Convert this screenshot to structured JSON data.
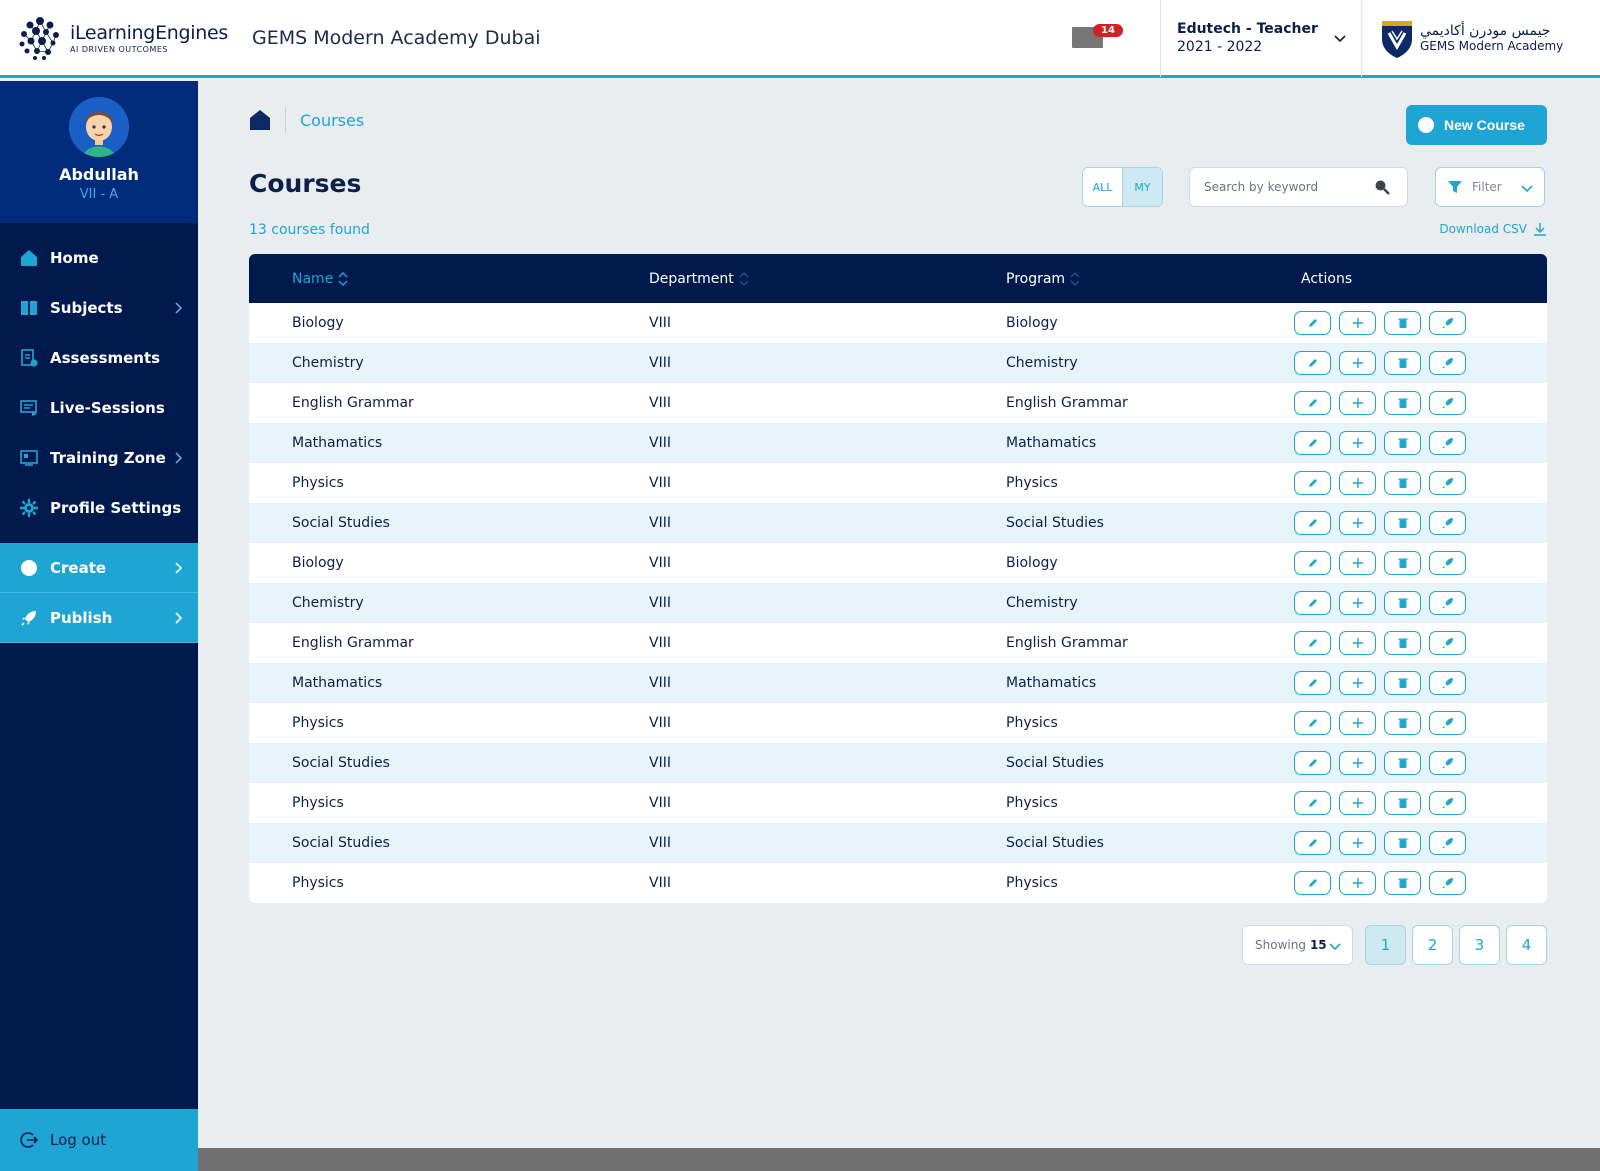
{
  "header": {
    "brand_name": "iLearningEngines",
    "brand_tag": "AI DRIVEN OUTCOMES",
    "school_name": "GEMS Modern Academy Dubai",
    "notification_count": "14",
    "role_title": "Edutech - Teacher",
    "role_year": "2021 - 2022",
    "partner_arabic": "جيمس مودرن أكاديمي",
    "partner_english": "GEMS Modern Academy"
  },
  "sidebar": {
    "user_name": "Abdullah",
    "user_class": "VII - A",
    "items": [
      {
        "label": "Home"
      },
      {
        "label": "Subjects"
      },
      {
        "label": "Assessments"
      },
      {
        "label": "Live-Sessions"
      },
      {
        "label": "Training Zone"
      },
      {
        "label": "Profile Settings"
      }
    ],
    "create_label": "Create",
    "publish_label": "Publish",
    "logout_label": "Log out"
  },
  "main": {
    "breadcrumb_label": "Courses",
    "new_course_label": "New Course",
    "title": "Courses",
    "toggle_all": "ALL",
    "toggle_my": "MY",
    "search_placeholder": "Search by keyword",
    "filter_label": "Filter",
    "found_text": "13 courses found",
    "download_label": "Download CSV",
    "columns": {
      "name": "Name",
      "department": "Department",
      "program": "Program",
      "actions": "Actions"
    },
    "rows": [
      {
        "name": "Biology",
        "department": "VIII",
        "program": "Biology"
      },
      {
        "name": "Chemistry",
        "department": "VIII",
        "program": "Chemistry"
      },
      {
        "name": "English Grammar",
        "department": "VIII",
        "program": "English Grammar"
      },
      {
        "name": "Mathamatics",
        "department": "VIII",
        "program": "Mathamatics"
      },
      {
        "name": "Physics",
        "department": "VIII",
        "program": "Physics"
      },
      {
        "name": "Social Studies",
        "department": "VIII",
        "program": "Social Studies"
      },
      {
        "name": "Biology",
        "department": "VIII",
        "program": "Biology"
      },
      {
        "name": "Chemistry",
        "department": "VIII",
        "program": "Chemistry"
      },
      {
        "name": "English Grammar",
        "department": "VIII",
        "program": "English Grammar"
      },
      {
        "name": "Mathamatics",
        "department": "VIII",
        "program": "Mathamatics"
      },
      {
        "name": "Physics",
        "department": "VIII",
        "program": "Physics"
      },
      {
        "name": "Social Studies",
        "department": "VIII",
        "program": "Social Studies"
      },
      {
        "name": "Physics",
        "department": "VIII",
        "program": "Physics"
      },
      {
        "name": "Social Studies",
        "department": "VIII",
        "program": "Social Studies"
      },
      {
        "name": "Physics",
        "department": "VIII",
        "program": "Physics"
      }
    ],
    "row_actions": [
      "edit-icon",
      "add-icon",
      "delete-icon",
      "rocket-icon"
    ],
    "pagination": {
      "showing_label": "Showing",
      "showing_value": "15",
      "pages": [
        "1",
        "2",
        "3",
        "4"
      ],
      "current": "1"
    }
  },
  "colors": {
    "accent": "#1ea5d4",
    "navy": "#001a4d",
    "row_alt": "#e7f4fa"
  }
}
